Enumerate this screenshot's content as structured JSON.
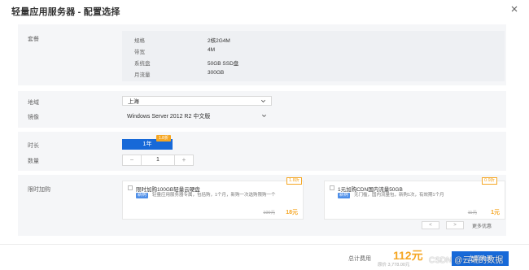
{
  "dialog": {
    "title": "轻量应用服务器 - 配置选择"
  },
  "package": {
    "label": "套餐",
    "specs": [
      {
        "label": "规格",
        "value": "2核2G4M"
      },
      {
        "label": "带宽",
        "value": "4M"
      },
      {
        "label": "系统盘",
        "value": "50GB SSD盘"
      },
      {
        "label": "月流量",
        "value": "300GB"
      }
    ]
  },
  "region": {
    "label": "地域",
    "value": "上海"
  },
  "image": {
    "label": "镜像",
    "value": "Windows Server 2012 R2 中文版"
  },
  "duration": {
    "label": "时长",
    "option": "1年",
    "badge": "1.8折"
  },
  "quantity": {
    "label": "数量",
    "minus": "−",
    "value": "1",
    "plus": "+"
  },
  "addons": {
    "label": "限时加购",
    "items": [
      {
        "badge": "1.8折",
        "name": "限时加购100GB轻量云硬盘",
        "tag": "新购",
        "desc": "轻量应用服务器专属，包括购，1个月，新购一次选购限购一个",
        "orig_price": "100元",
        "price": "18元"
      },
      {
        "badge": "0.9折",
        "name": "1元加购CDN国内流量50GB",
        "tag": "新购",
        "desc": "无门槛，国内流量包，新购1次，有效期1个月",
        "orig_price": "11元",
        "price": "1元"
      }
    ],
    "pager": {
      "prev": "<",
      "next": ">",
      "label": "更多优惠"
    }
  },
  "footer": {
    "total_label": "总计费用",
    "total_price": "112元",
    "total_orig": "原价 3,778.00元",
    "buy_label": "立即购买",
    "watermark": "CSDN @云端的数据"
  },
  "colors": {
    "primary": "#1769d8",
    "accent": "#f5a623",
    "panel": "#f5f6f8"
  }
}
